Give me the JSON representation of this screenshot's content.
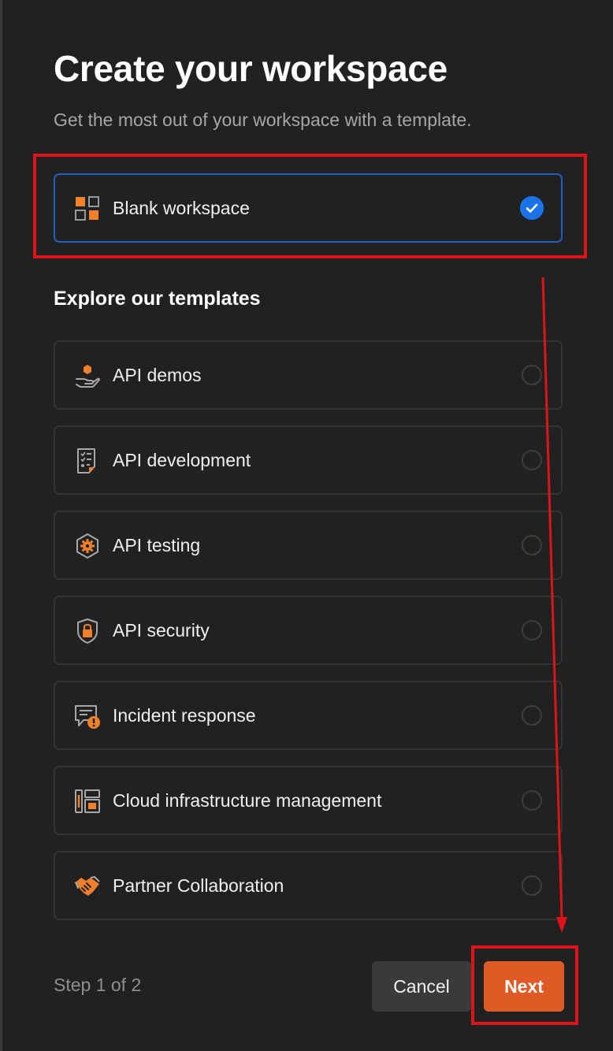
{
  "header": {
    "title": "Create your workspace",
    "subtitle": "Get the most out of your workspace with a template."
  },
  "blank_option": {
    "label": "Blank workspace",
    "icon": "grid-squares-icon",
    "selected": true
  },
  "templates": {
    "heading": "Explore our templates",
    "items": [
      {
        "label": "API demos",
        "icon": "hand-holding-hexagon-icon",
        "selected": false
      },
      {
        "label": "API development",
        "icon": "checklist-document-icon",
        "selected": false
      },
      {
        "label": "API testing",
        "icon": "gear-hexagon-icon",
        "selected": false
      },
      {
        "label": "API security",
        "icon": "shield-lock-icon",
        "selected": false
      },
      {
        "label": "Incident response",
        "icon": "chat-alert-icon",
        "selected": false
      },
      {
        "label": "Cloud infrastructure management",
        "icon": "server-rack-icon",
        "selected": false
      },
      {
        "label": "Partner Collaboration",
        "icon": "handshake-icon",
        "selected": false
      }
    ]
  },
  "footer": {
    "step_text": "Step 1 of 2",
    "cancel_label": "Cancel",
    "next_label": "Next"
  },
  "colors": {
    "background": "#212121",
    "selected_border": "#1f5fbd",
    "check_blue": "#1a73e8",
    "primary_orange": "#e05a26",
    "annotation_red": "#e0131a",
    "icon_orange": "#f0812a"
  }
}
